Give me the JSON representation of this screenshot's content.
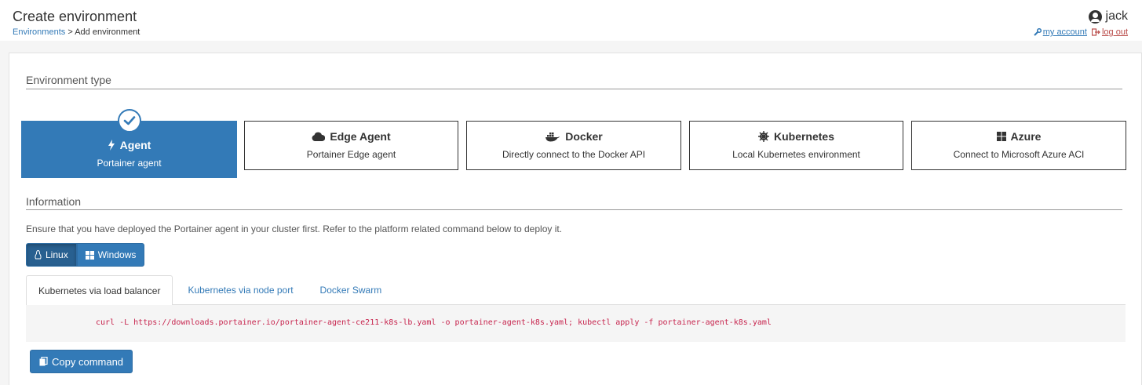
{
  "header": {
    "title": "Create environment",
    "breadcrumb_link": "Environments",
    "breadcrumb_current": "> Add environment",
    "username": "jack",
    "my_account": "my account",
    "log_out": "log out"
  },
  "env_type": {
    "section_title": "Environment type",
    "cards": [
      {
        "title": "Agent",
        "desc": "Portainer agent",
        "icon": "bolt-icon",
        "selected": true
      },
      {
        "title": "Edge Agent",
        "desc": "Portainer Edge agent",
        "icon": "cloud-icon"
      },
      {
        "title": "Docker",
        "desc": "Directly connect to the Docker API",
        "icon": "docker-icon"
      },
      {
        "title": "Kubernetes",
        "desc": "Local Kubernetes environment",
        "icon": "helm-icon"
      },
      {
        "title": "Azure",
        "desc": "Connect to Microsoft Azure ACI",
        "icon": "windows-icon"
      }
    ]
  },
  "information": {
    "section_title": "Information",
    "text": "Ensure that you have deployed the Portainer agent in your cluster first. Refer to the platform related command below to deploy it.",
    "os_options": [
      "Linux",
      "Windows"
    ],
    "os_selected": "Linux",
    "tabs": [
      "Kubernetes via load balancer",
      "Kubernetes via node port",
      "Docker Swarm"
    ],
    "active_tab": "Kubernetes via load balancer",
    "command": "curl -L https://downloads.portainer.io/portainer-agent-ce211-k8s-lb.yaml -o portainer-agent-k8s.yaml; kubectl apply -f portainer-agent-k8s.yaml",
    "copy_label": "Copy command"
  },
  "colors": {
    "primary": "#337ab7",
    "logout": "#b94a48",
    "code": "#c7254e"
  }
}
